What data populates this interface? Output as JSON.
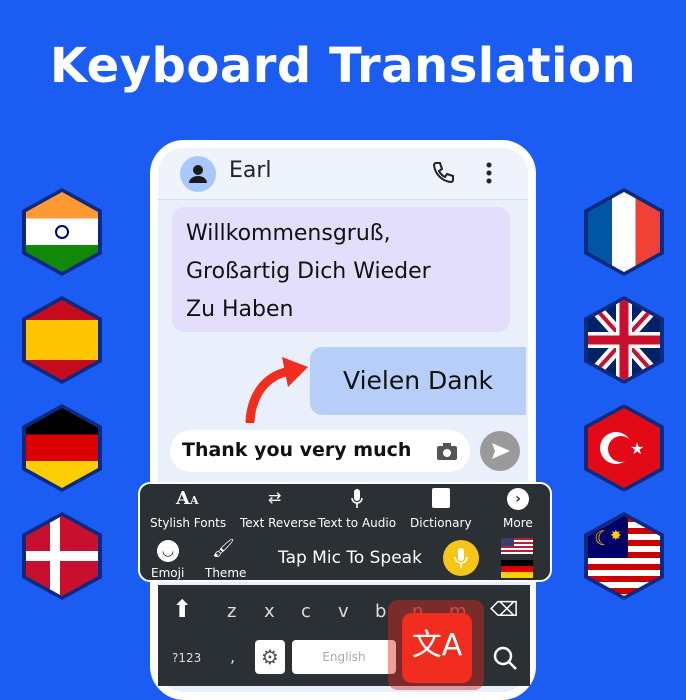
{
  "title": "Keyboard Translation",
  "chat": {
    "contact_name": "Earl",
    "received_message": [
      "Willkommensgruß,",
      "Großartig Dich Wieder",
      "Zu Haben"
    ],
    "sent_message": "Vielen Dank",
    "input_value": "Thank you very much"
  },
  "toolbar": {
    "items": [
      "Stylish Fonts",
      "Text Reverse",
      "Text to Audio",
      "Dictionary",
      "More"
    ],
    "emoji": "Emoji",
    "theme": "Theme",
    "mic_prompt": "Tap Mic To Speak",
    "languages": [
      "English (US)",
      "German"
    ]
  },
  "keyboard": {
    "letters": [
      "z",
      "x",
      "c",
      "v",
      "b",
      "n",
      "m"
    ],
    "hints": [
      "•",
      "\"",
      "'",
      ":",
      ";",
      "!",
      "?"
    ],
    "symbols_key": "?123",
    "comma_key": ",",
    "space_label": "English"
  },
  "flags_left": [
    "India",
    "Spain",
    "Germany",
    "Denmark"
  ],
  "flags_right": [
    "France",
    "United Kingdom",
    "Turkey",
    "Malaysia"
  ],
  "colors": {
    "background": "#1b5cf2",
    "accent_red": "#f02d1e",
    "mic_yellow": "#f5c518",
    "toolbar": "#2b3035"
  }
}
